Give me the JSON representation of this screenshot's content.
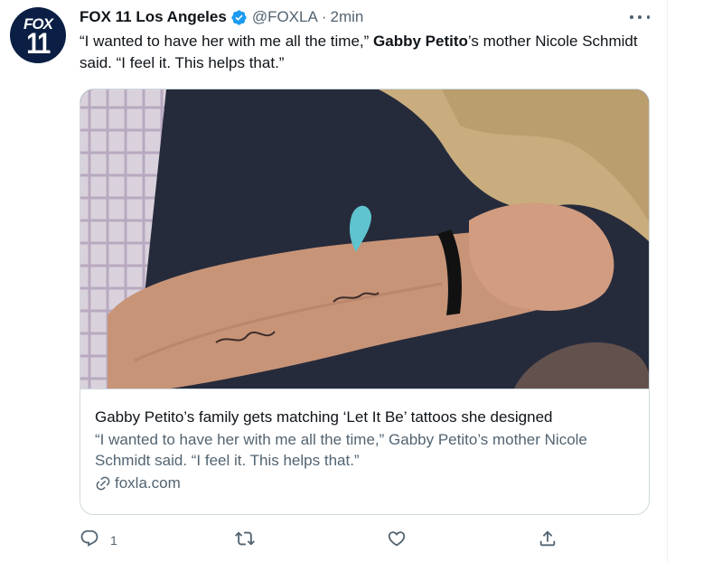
{
  "tweet": {
    "author_name": "FOX 11 Los Angeles",
    "handle": "@FOXLA",
    "separator": "·",
    "time": "2min",
    "avatar": {
      "line1": "FOX",
      "line2": "11",
      "bg": "#0b1f44"
    },
    "text": {
      "part1": "“I wanted to have her with me all the time,” ",
      "bold": "Gabby Petito",
      "part2": "’s mother Nicole Schmidt said. “I feel it. This helps that.”"
    },
    "verified_color": "#1d9bf0"
  },
  "card": {
    "title": "Gabby Petito’s family gets matching ‘Let It Be’ tattoos she designed",
    "description": "“I wanted to have her with me all the time,” Gabby Petito’s mother Nicole Schmidt said. “I feel it. This helps that.”",
    "domain": "foxla.com"
  },
  "actions": {
    "reply_count": "1",
    "retweet_count": "",
    "like_count": ""
  },
  "icons": [
    "verified-badge-icon",
    "more-options-icon",
    "link-icon",
    "reply-icon",
    "retweet-icon",
    "like-icon",
    "share-icon"
  ]
}
